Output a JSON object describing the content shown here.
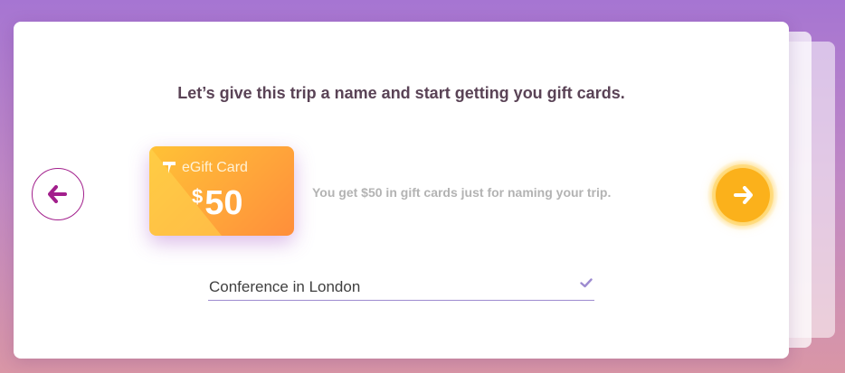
{
  "colors": {
    "accent_purple": "#a21f8c",
    "next_yellow": "#fbb11b",
    "card_orange_start": "#ffc236",
    "card_orange_end": "#ff8e3a",
    "check_purple": "#9d8bd0"
  },
  "headline": "Let’s give this trip a name and start getting you gift cards.",
  "gift_card": {
    "title": "eGift Card",
    "currency": "$",
    "amount": "50",
    "logo_icon": "flag-logo-icon"
  },
  "promo_text": "You get $50 in gift cards just for naming your trip.",
  "trip_name": {
    "value": "Conference in London",
    "status_icon": "check-icon"
  },
  "navigation": {
    "back_icon": "arrow-left-icon",
    "next_icon": "arrow-right-icon"
  }
}
